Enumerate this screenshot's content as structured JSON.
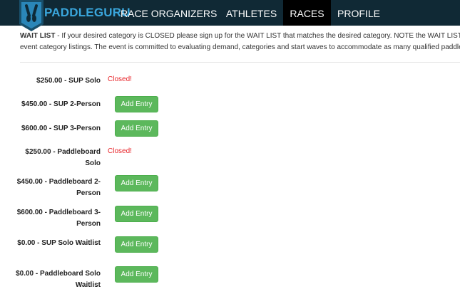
{
  "brand": {
    "name": "PADDLEGURU",
    "color": "#3aa6dc",
    "nav_bg": "#102935"
  },
  "nav": {
    "items": [
      {
        "label": "RACE ORGANIZERS",
        "active": false
      },
      {
        "label": "ATHLETES",
        "active": false
      },
      {
        "label": "RACES",
        "active": true
      },
      {
        "label": "PROFILE",
        "active": false
      }
    ]
  },
  "waitlist": {
    "heading": "WAIT LIST",
    "line1": " - If your desired category is CLOSED please sign up for the WAIT LIST that matches the desired category.   NOTE the WAIT LIST ca",
    "line2": "event category  listings.  The event is committed to evaluating demand, categories and start waves to accommodate as many qualified paddlers"
  },
  "entries": [
    {
      "name": "$250.00 - SUP Solo",
      "status": "Closed!"
    },
    {
      "name": "$450.00 - SUP 2-Person",
      "button": "Add Entry"
    },
    {
      "name": "$600.00 - SUP 3-Person",
      "button": "Add Entry"
    },
    {
      "name": "$250.00 - Paddleboard Solo",
      "status": "Closed!"
    },
    {
      "name": "$450.00 - Paddleboard 2-Person",
      "button": "Add Entry"
    },
    {
      "name": "$600.00 - Paddleboard 3-Person",
      "button": "Add Entry"
    },
    {
      "name": "$0.00 - SUP Solo Waitlist",
      "button": "Add Entry"
    },
    {
      "name": "$0.00 - Paddleboard Solo Waitlist",
      "button": "Add Entry"
    }
  ],
  "colors": {
    "button_green": "#5cb85c",
    "closed_red": "#e8262b"
  },
  "icons": {
    "logo": "paddle-shield-logo-icon"
  }
}
